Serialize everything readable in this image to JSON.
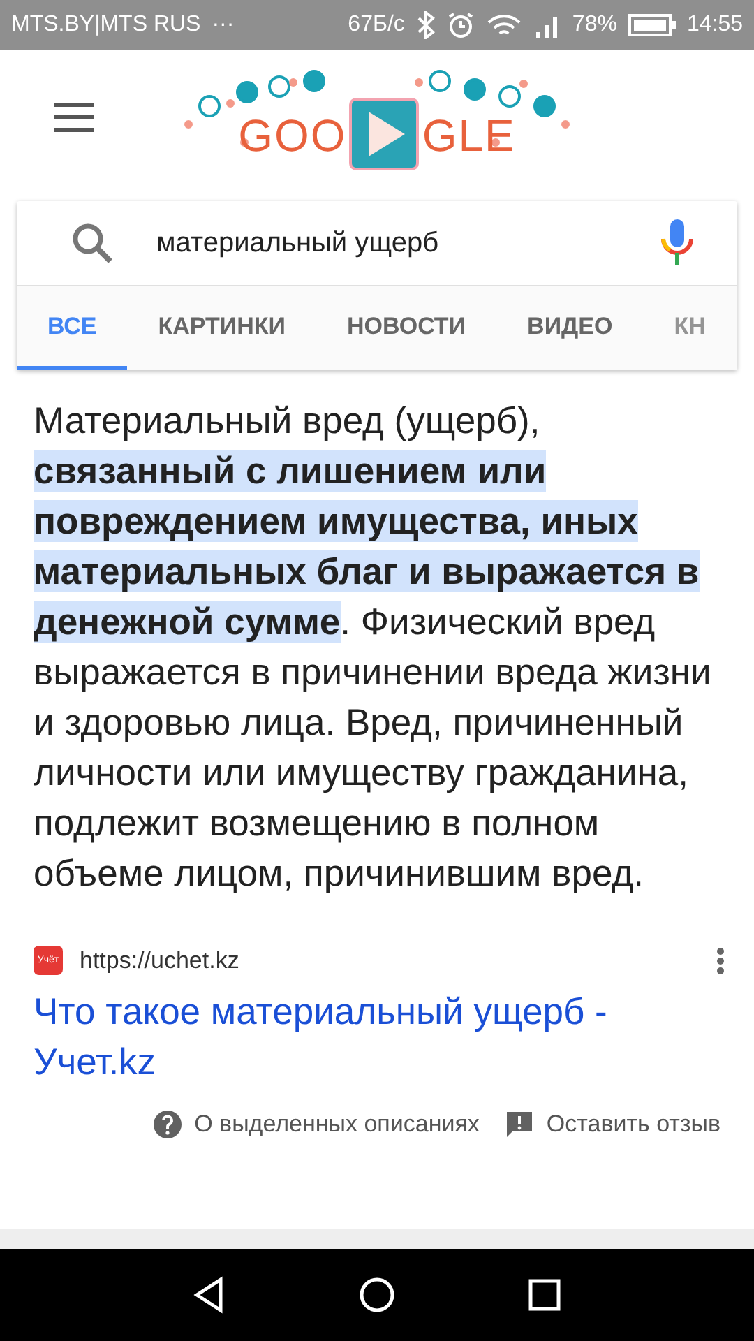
{
  "status_bar": {
    "carrier": "MTS.BY|MTS RUS",
    "dots": "···",
    "speed": "67Б/с",
    "battery": "78%",
    "time": "14:55"
  },
  "header": {
    "logo_left": "GOO",
    "logo_right": "GLE"
  },
  "search": {
    "value": "материальный ущерб"
  },
  "tabs": [
    {
      "label": "ВСЕ",
      "selected": true
    },
    {
      "label": "КАРТИНКИ",
      "selected": false
    },
    {
      "label": "НОВОСТИ",
      "selected": false
    },
    {
      "label": "ВИДЕО",
      "selected": false
    },
    {
      "label": "КН",
      "selected": false
    }
  ],
  "snippet": {
    "text": "Материальный вред (ущерб), **связанный с лишением или повреждением имущества, иных материальных благ и выражается в денежной сумме**. Физический вред выражается в причинении вреда жизни и здоровью лица. Вред, причиненный личности или имуществу гражданина, подлежит возмещению в полном объеме лицом, причинившим вред."
  },
  "source": {
    "favicon_text": "Учёт",
    "url": "https://uchet.kz",
    "title": "Что такое материальный ущерб - Учет.kz"
  },
  "footer": {
    "about": "О выделенных описаниях",
    "feedback": "Оставить отзыв"
  }
}
